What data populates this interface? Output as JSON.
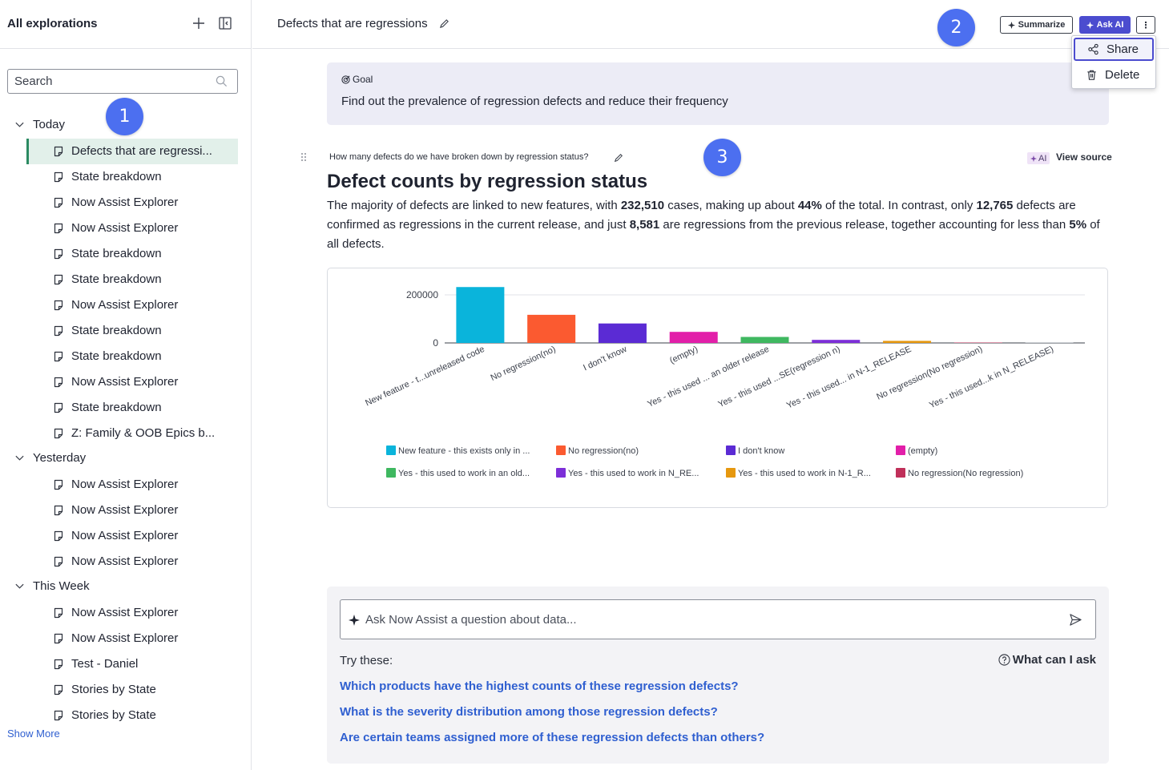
{
  "sidebar": {
    "title": "All explorations",
    "search_placeholder": "Search",
    "groups": [
      {
        "label": "Today",
        "items": [
          "Defects that are regressi...",
          "State breakdown",
          "Now Assist Explorer",
          "Now Assist Explorer",
          "State breakdown",
          "State breakdown",
          "Now Assist Explorer",
          "State breakdown",
          "State breakdown",
          "Now Assist Explorer",
          "State breakdown",
          "Z: Family & OOB Epics b..."
        ]
      },
      {
        "label": "Yesterday",
        "items": [
          "Now Assist Explorer",
          "Now Assist Explorer",
          "Now Assist Explorer",
          "Now Assist Explorer"
        ]
      },
      {
        "label": "This Week",
        "items": [
          "Now Assist Explorer",
          "Now Assist Explorer",
          "Test - Daniel",
          "Stories by State",
          "Stories by State"
        ]
      }
    ],
    "show_more": "Show More"
  },
  "header": {
    "title": "Defects that are regressions",
    "summarize": "Summarize",
    "ask_ai": "Ask AI",
    "more": "⋮"
  },
  "menu": {
    "share": "Share",
    "delete": "Delete"
  },
  "badges": [
    "1",
    "2",
    "3"
  ],
  "goal": {
    "label": "Goal",
    "text": "Find out the prevalence of regression defects and reduce their frequency"
  },
  "insight": {
    "question": "How many defects do we have broken down by regression status?",
    "ai_chip": "AI",
    "view_source": "View source",
    "title": "Defect counts by regression status",
    "summary_parts": [
      "The majority of defects are linked to new features, with ",
      "232,510",
      " cases, making up about ",
      "44%",
      " of the total. In contrast, only ",
      "12,765",
      " defects are confirmed as regressions in the current release, and just ",
      "8,581",
      " are regressions from the previous release, together accounting for less than ",
      "5%",
      " of all defects."
    ]
  },
  "chart_data": {
    "type": "bar",
    "categories": [
      "New feature - t...unreleased code",
      "No regression(no)",
      "I don't know",
      "(empty)",
      "Yes - this used ... an older release",
      "Yes - this used ...SE(regression n)",
      "Yes - this used... in N-1_RELEASE",
      "No regression(No regression)",
      "Yes - this used...k in N_RELEASE)"
    ],
    "values": [
      232510,
      117000,
      81000,
      46000,
      25000,
      12765,
      8581,
      700,
      300
    ],
    "colors": [
      "#0ab4db",
      "#fb5a30",
      "#5b2bd4",
      "#e21fa9",
      "#3fb860",
      "#7d2fd8",
      "#e6980f",
      "#c0305a",
      "#9aa0aa"
    ],
    "yticks": [
      0,
      200000
    ],
    "ylim": [
      0,
      250000
    ],
    "legend": [
      {
        "label": "New feature - this exists only in ...",
        "color": "#0ab4db"
      },
      {
        "label": "No regression(no)",
        "color": "#fb5a30"
      },
      {
        "label": "I don't know",
        "color": "#5b2bd4"
      },
      {
        "label": "(empty)",
        "color": "#e21fa9"
      },
      {
        "label": "Yes - this used to work in an old...",
        "color": "#3fb860"
      },
      {
        "label": "Yes - this used to work in N_RE...",
        "color": "#7d2fd8"
      },
      {
        "label": "Yes - this used to work in N-1_R...",
        "color": "#e6980f"
      },
      {
        "label": "No regression(No regression)",
        "color": "#c0305a"
      }
    ],
    "legend_position": "bottom",
    "grid": true
  },
  "ask": {
    "placeholder": "Ask Now Assist a question about data...",
    "try_these": "Try these:",
    "what_can_i_ask": "What can I ask",
    "suggestions": [
      "Which products have the highest counts of these regression defects?",
      "What is the severity distribution among those regression defects?",
      "Are certain teams assigned more of these regression defects than others?"
    ]
  }
}
